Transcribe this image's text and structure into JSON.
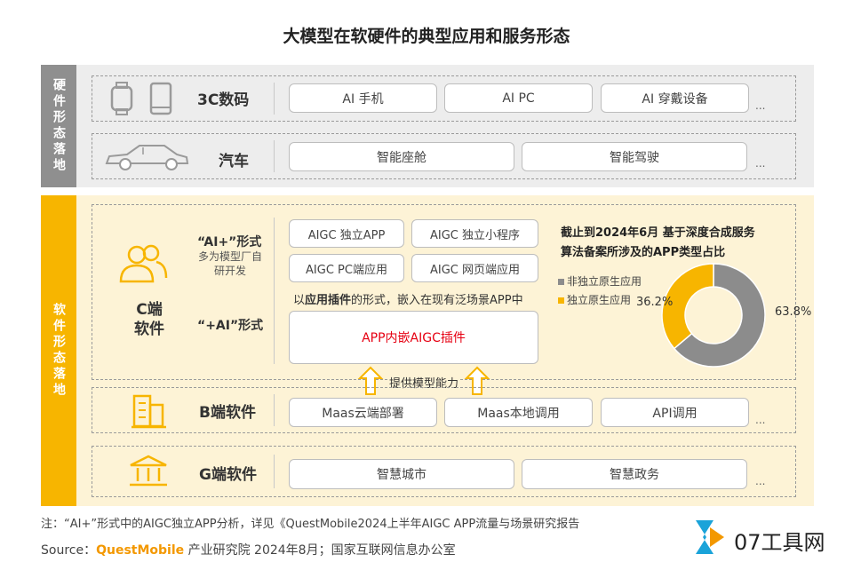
{
  "title": "大模型在软硬件的典型应用和服务形态",
  "hardware": {
    "side_label": "硬件形态落地",
    "rows": [
      {
        "label": "3C数码",
        "items": [
          "AI 手机",
          "AI PC",
          "AI 穿戴设备"
        ],
        "more": "..."
      },
      {
        "label": "汽车",
        "items": [
          "智能座舱",
          "智能驾驶"
        ],
        "more": "..."
      }
    ]
  },
  "software": {
    "side_label": "软件形态落地",
    "c": {
      "label": "C端\n软件",
      "ai_plus": "“AI+”形式",
      "ai_plus_sub": "多为模型厂自\n研开发",
      "plus_ai": "“+AI”形式",
      "items": [
        "AIGC 独立APP",
        "AIGC 独立小程序",
        "AIGC PC端应用",
        "AIGC 网页端应用"
      ],
      "plugin_note_prefix": "以",
      "plugin_note_bold": "应用插件",
      "plugin_note_suffix": "的形式，嵌入在现有泛场景APP中",
      "plugin_box": "APP内嵌AIGC插件",
      "capability": "提供模型能力"
    },
    "b": {
      "label": "B端软件",
      "items": [
        "Maas云端部署",
        "Maas本地调用",
        "API调用"
      ],
      "more": "..."
    },
    "g": {
      "label": "G端软件",
      "items": [
        "智慧城市",
        "智慧政务"
      ],
      "more": "..."
    }
  },
  "chart_data": {
    "type": "pie",
    "title": "截止到2024年6月 基于深度合成服务算法备案所涉及的APP类型占比",
    "slices": [
      {
        "name": "非独立原生应用",
        "value": 63.8,
        "label": "63.8%",
        "color": "#8c8c8c"
      },
      {
        "name": "独立原生应用",
        "value": 36.2,
        "label": "36.2%",
        "color": "#f7b500"
      }
    ]
  },
  "footer": {
    "note": "注：“AI+”形式中的AIGC独立APP分析，详见《QuestMobile2024上半年AIGC APP流量与场景研究报告",
    "source_prefix": "Source：",
    "source_brand": "QuestMobile",
    "source_rest": " 产业研究院 2024年8月；国家互联网信息办公室",
    "logo_text": "07工具网"
  },
  "colors": {
    "accent_yellow": "#f7b500",
    "grey": "#8f8f8f",
    "brand_orange": "#f39800",
    "plugin_red": "#e60012"
  }
}
